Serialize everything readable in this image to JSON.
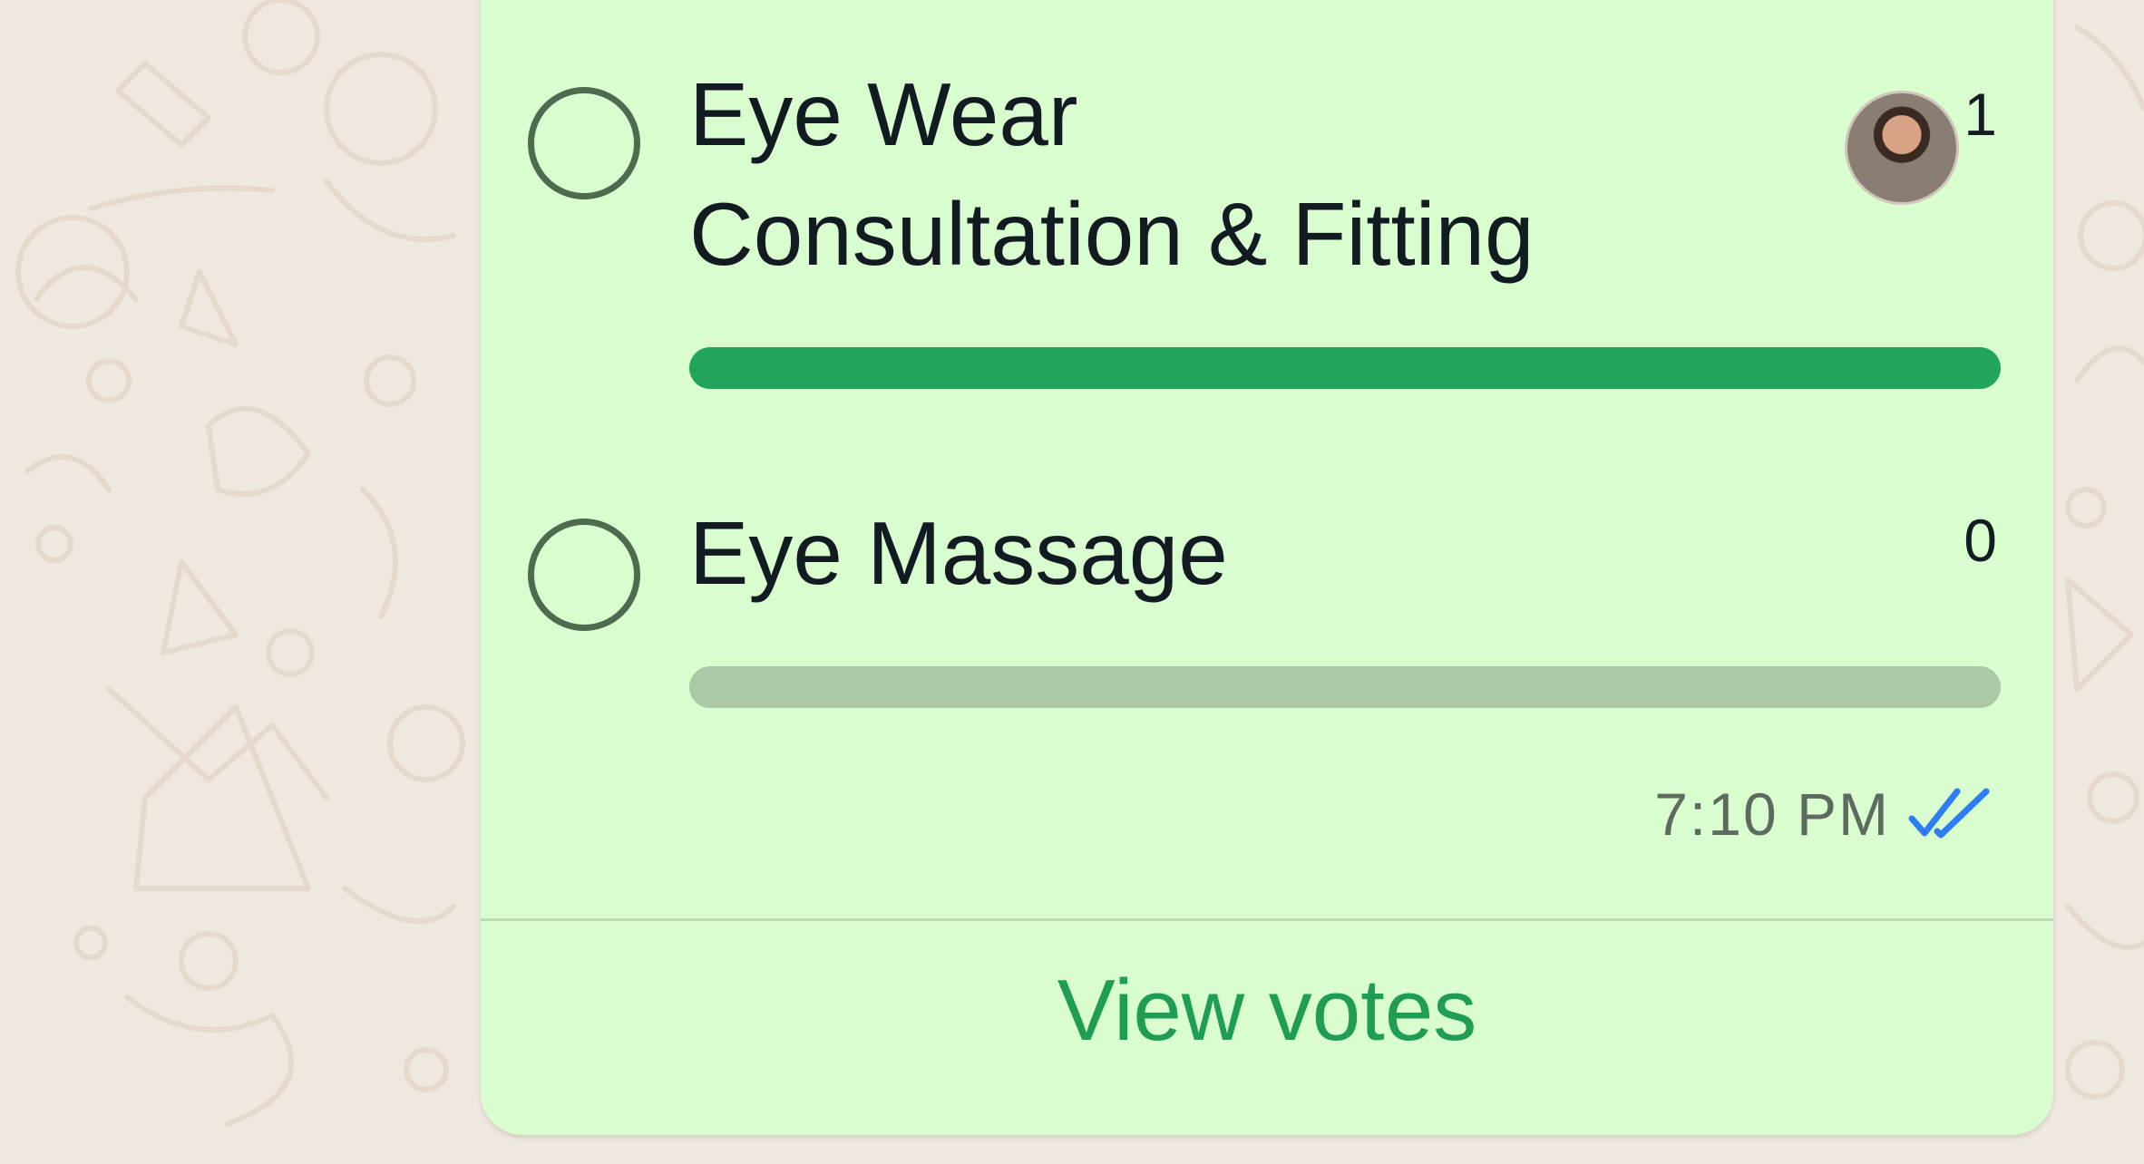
{
  "poll": {
    "options": [
      {
        "label": "Eye Wear Consultation & Fitting",
        "votes": "1",
        "fraction": 1.0
      },
      {
        "label": "Eye Massage",
        "votes": "0",
        "fraction": 0.0
      }
    ],
    "timestamp": "7:10 PM",
    "read_status": "read",
    "view_votes_label": "View votes"
  },
  "colors": {
    "bubble": "#dafdd0",
    "accent": "#1f9d55",
    "bar_fill": "#22a55b",
    "bar_track": "#abc9a6",
    "read_ticks": "#2c7df6",
    "background": "#efe8de"
  }
}
